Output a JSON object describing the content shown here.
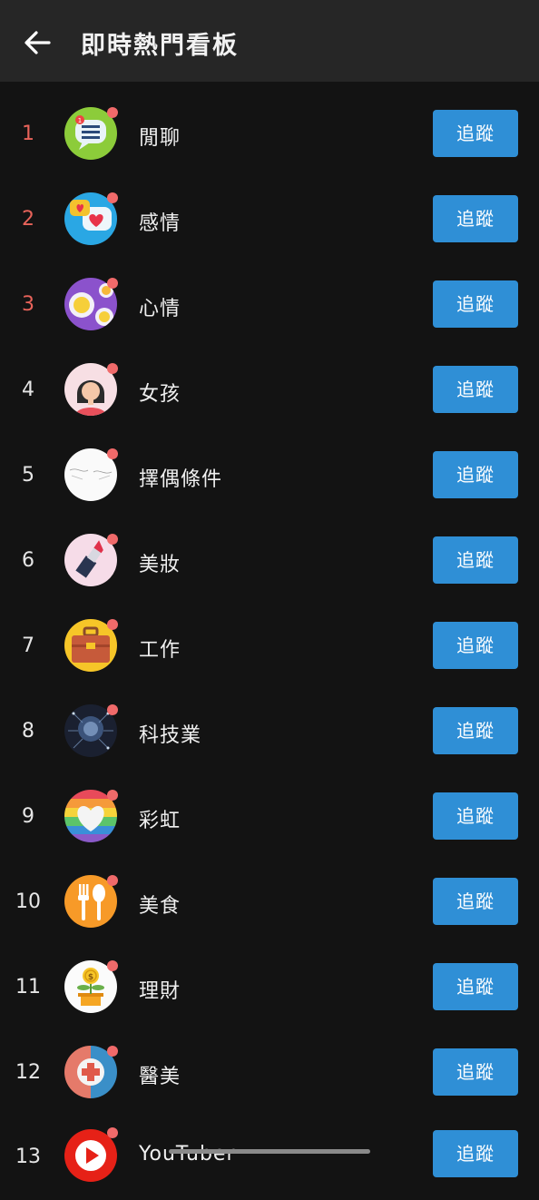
{
  "header": {
    "title": "即時熱門看板",
    "back_icon": "arrow-left-icon"
  },
  "colors": {
    "follow_button": "#2f8fd6",
    "hot_rank": "#e8635a",
    "badge_dot": "#f06a6a"
  },
  "boards": [
    {
      "rank": "1",
      "name": "閒聊",
      "follow": "追蹤",
      "icon": "chat-bubble-icon"
    },
    {
      "rank": "2",
      "name": "感情",
      "follow": "追蹤",
      "icon": "hearts-bubble-icon"
    },
    {
      "rank": "3",
      "name": "心情",
      "follow": "追蹤",
      "icon": "emoji-faces-icon"
    },
    {
      "rank": "4",
      "name": "女孩",
      "follow": "追蹤",
      "icon": "girl-avatar-icon"
    },
    {
      "rank": "5",
      "name": "擇偶條件",
      "follow": "追蹤",
      "icon": "sketch-icon"
    },
    {
      "rank": "6",
      "name": "美妝",
      "follow": "追蹤",
      "icon": "lipstick-icon"
    },
    {
      "rank": "7",
      "name": "工作",
      "follow": "追蹤",
      "icon": "briefcase-icon"
    },
    {
      "rank": "8",
      "name": "科技業",
      "follow": "追蹤",
      "icon": "tech-brain-icon"
    },
    {
      "rank": "9",
      "name": "彩虹",
      "follow": "追蹤",
      "icon": "rainbow-heart-icon"
    },
    {
      "rank": "10",
      "name": "美食",
      "follow": "追蹤",
      "icon": "fork-spoon-icon"
    },
    {
      "rank": "11",
      "name": "理財",
      "follow": "追蹤",
      "icon": "money-plant-icon"
    },
    {
      "rank": "12",
      "name": "醫美",
      "follow": "追蹤",
      "icon": "medical-cross-icon"
    },
    {
      "rank": "13",
      "name": "YouTuber",
      "follow": "追蹤",
      "icon": "youtube-play-icon"
    }
  ]
}
